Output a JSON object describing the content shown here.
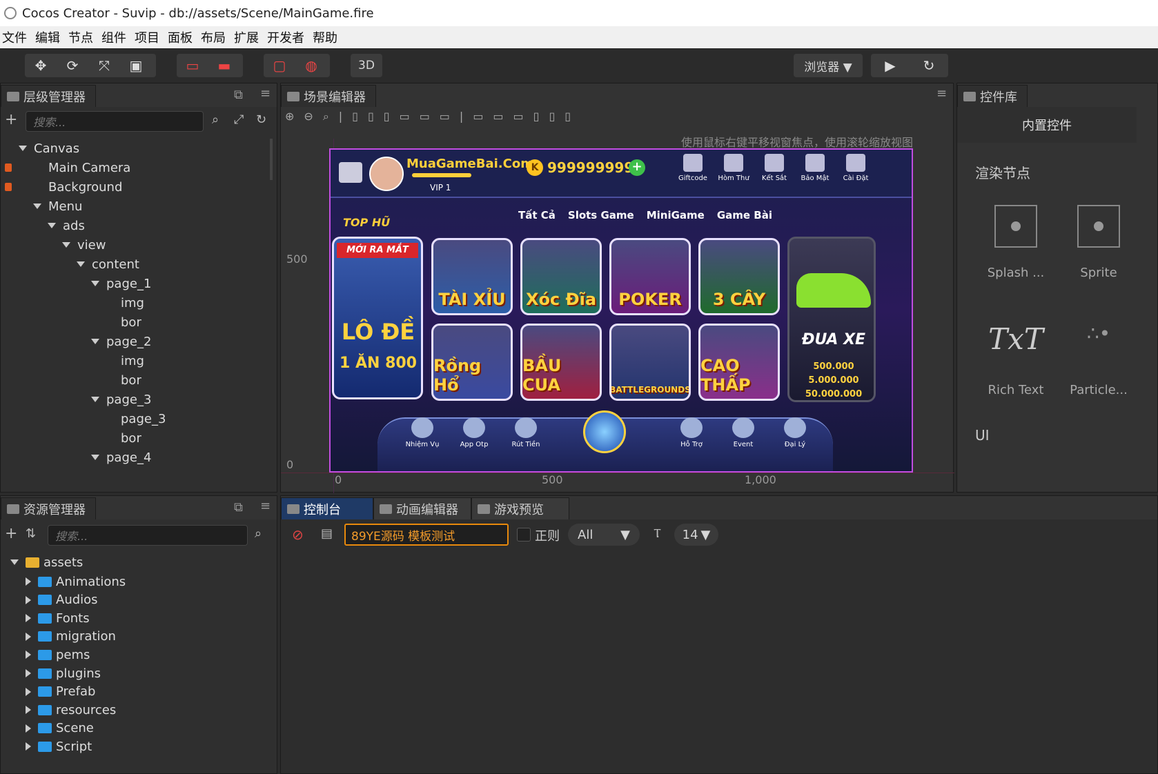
{
  "window": {
    "title": "Cocos Creator - Suvip - db://assets/Scene/MainGame.fire"
  },
  "menu": [
    "文件",
    "编辑",
    "节点",
    "组件",
    "项目",
    "面板",
    "布局",
    "扩展",
    "开发者",
    "帮助"
  ],
  "toolbar": {
    "mode_3d": "3D",
    "browser": "浏览器 ▼"
  },
  "hierarchy": {
    "title": "层级管理器",
    "search_placeholder": "搜索...",
    "nodes": [
      {
        "label": "Canvas",
        "depth": 0,
        "arrow": "down",
        "lock": false
      },
      {
        "label": "Main Camera",
        "depth": 1,
        "arrow": "none",
        "lock": true
      },
      {
        "label": "Background",
        "depth": 1,
        "arrow": "none",
        "lock": true
      },
      {
        "label": "Menu",
        "depth": 1,
        "arrow": "down",
        "lock": false
      },
      {
        "label": "ads",
        "depth": 2,
        "arrow": "down",
        "lock": false
      },
      {
        "label": "view",
        "depth": 3,
        "arrow": "down",
        "lock": false
      },
      {
        "label": "content",
        "depth": 4,
        "arrow": "down",
        "lock": false
      },
      {
        "label": "page_1",
        "depth": 5,
        "arrow": "down",
        "lock": false
      },
      {
        "label": "img",
        "depth": 6,
        "arrow": "none",
        "lock": false
      },
      {
        "label": "bor",
        "depth": 6,
        "arrow": "none",
        "lock": false
      },
      {
        "label": "page_2",
        "depth": 5,
        "arrow": "down",
        "lock": false
      },
      {
        "label": "img",
        "depth": 6,
        "arrow": "none",
        "lock": false
      },
      {
        "label": "bor",
        "depth": 6,
        "arrow": "none",
        "lock": false
      },
      {
        "label": "page_3",
        "depth": 5,
        "arrow": "down",
        "lock": false
      },
      {
        "label": "page_3",
        "depth": 6,
        "arrow": "none",
        "lock": false
      },
      {
        "label": "bor",
        "depth": 6,
        "arrow": "none",
        "lock": false
      },
      {
        "label": "page_4",
        "depth": 5,
        "arrow": "down",
        "lock": false
      }
    ]
  },
  "scene": {
    "title": "场景编辑器",
    "hint": "使用鼠标右键平移视窗焦点，使用滚轮缩放视图",
    "ruler_y": [
      "500",
      "0"
    ],
    "ruler_x": [
      "0",
      "500",
      "1,000"
    ],
    "game": {
      "site": "MuaGameBai.Com",
      "coins": "999999999",
      "vip": "VIP 1",
      "top_label": "TOP HŨ",
      "top_icons": [
        "Giftcode",
        "Hòm Thư",
        "Kết Sắt",
        "Bảo Mật",
        "Cài Đặt"
      ],
      "tabs": [
        "Tất Cả",
        "Slots Game",
        "MiniGame",
        "Game Bài"
      ],
      "banner": {
        "ribbon": "MỚI RA MẮT",
        "title": "LÔ ĐỀ",
        "sub": "1 ĂN 800"
      },
      "tiles": [
        {
          "label": "TÀI XỈU",
          "color": "#2d5ea8"
        },
        {
          "label": "Xóc Đĩa",
          "color": "#1e6f5a"
        },
        {
          "label": "POKER",
          "color": "#6b1c7a"
        },
        {
          "label": "3 CÂY",
          "color": "#1f6b2c"
        },
        {
          "label": "Rồng Hổ",
          "color": "#3a4aa0"
        },
        {
          "label": "BẦU CUA",
          "color": "#a02040"
        },
        {
          "label": "BATTLEGROUNDS",
          "color": "#23346e"
        },
        {
          "label": "CAO THẤP",
          "color": "#8a2f8a"
        }
      ],
      "race": {
        "title": "ĐUA XE",
        "values": [
          "500.000",
          "5.000.000",
          "50.000.000"
        ]
      },
      "bottom_icons": [
        "Nhiệm Vụ",
        "App Otp",
        "Rút Tiền",
        "Hỗ Trợ",
        "Event",
        "Đại Lý"
      ]
    }
  },
  "library": {
    "title": "控件库",
    "tab": "内置控件",
    "section_render": "渲染节点",
    "section_ui": "UI",
    "items": [
      "Splash ...",
      "Sprite",
      "Rich Text",
      "Particle..."
    ]
  },
  "assets": {
    "title": "资源管理器",
    "search_placeholder": "搜索...",
    "root": "assets",
    "folders": [
      "Animations",
      "Audios",
      "Fonts",
      "migration",
      "pems",
      "plugins",
      "Prefab",
      "resources",
      "Scene",
      "Script"
    ]
  },
  "console": {
    "tabs": [
      "控制台",
      "动画编辑器",
      "游戏预览"
    ],
    "filter_value": "89YE源码 模板测试",
    "regex": "正则",
    "level": "All",
    "font_size": "14"
  }
}
